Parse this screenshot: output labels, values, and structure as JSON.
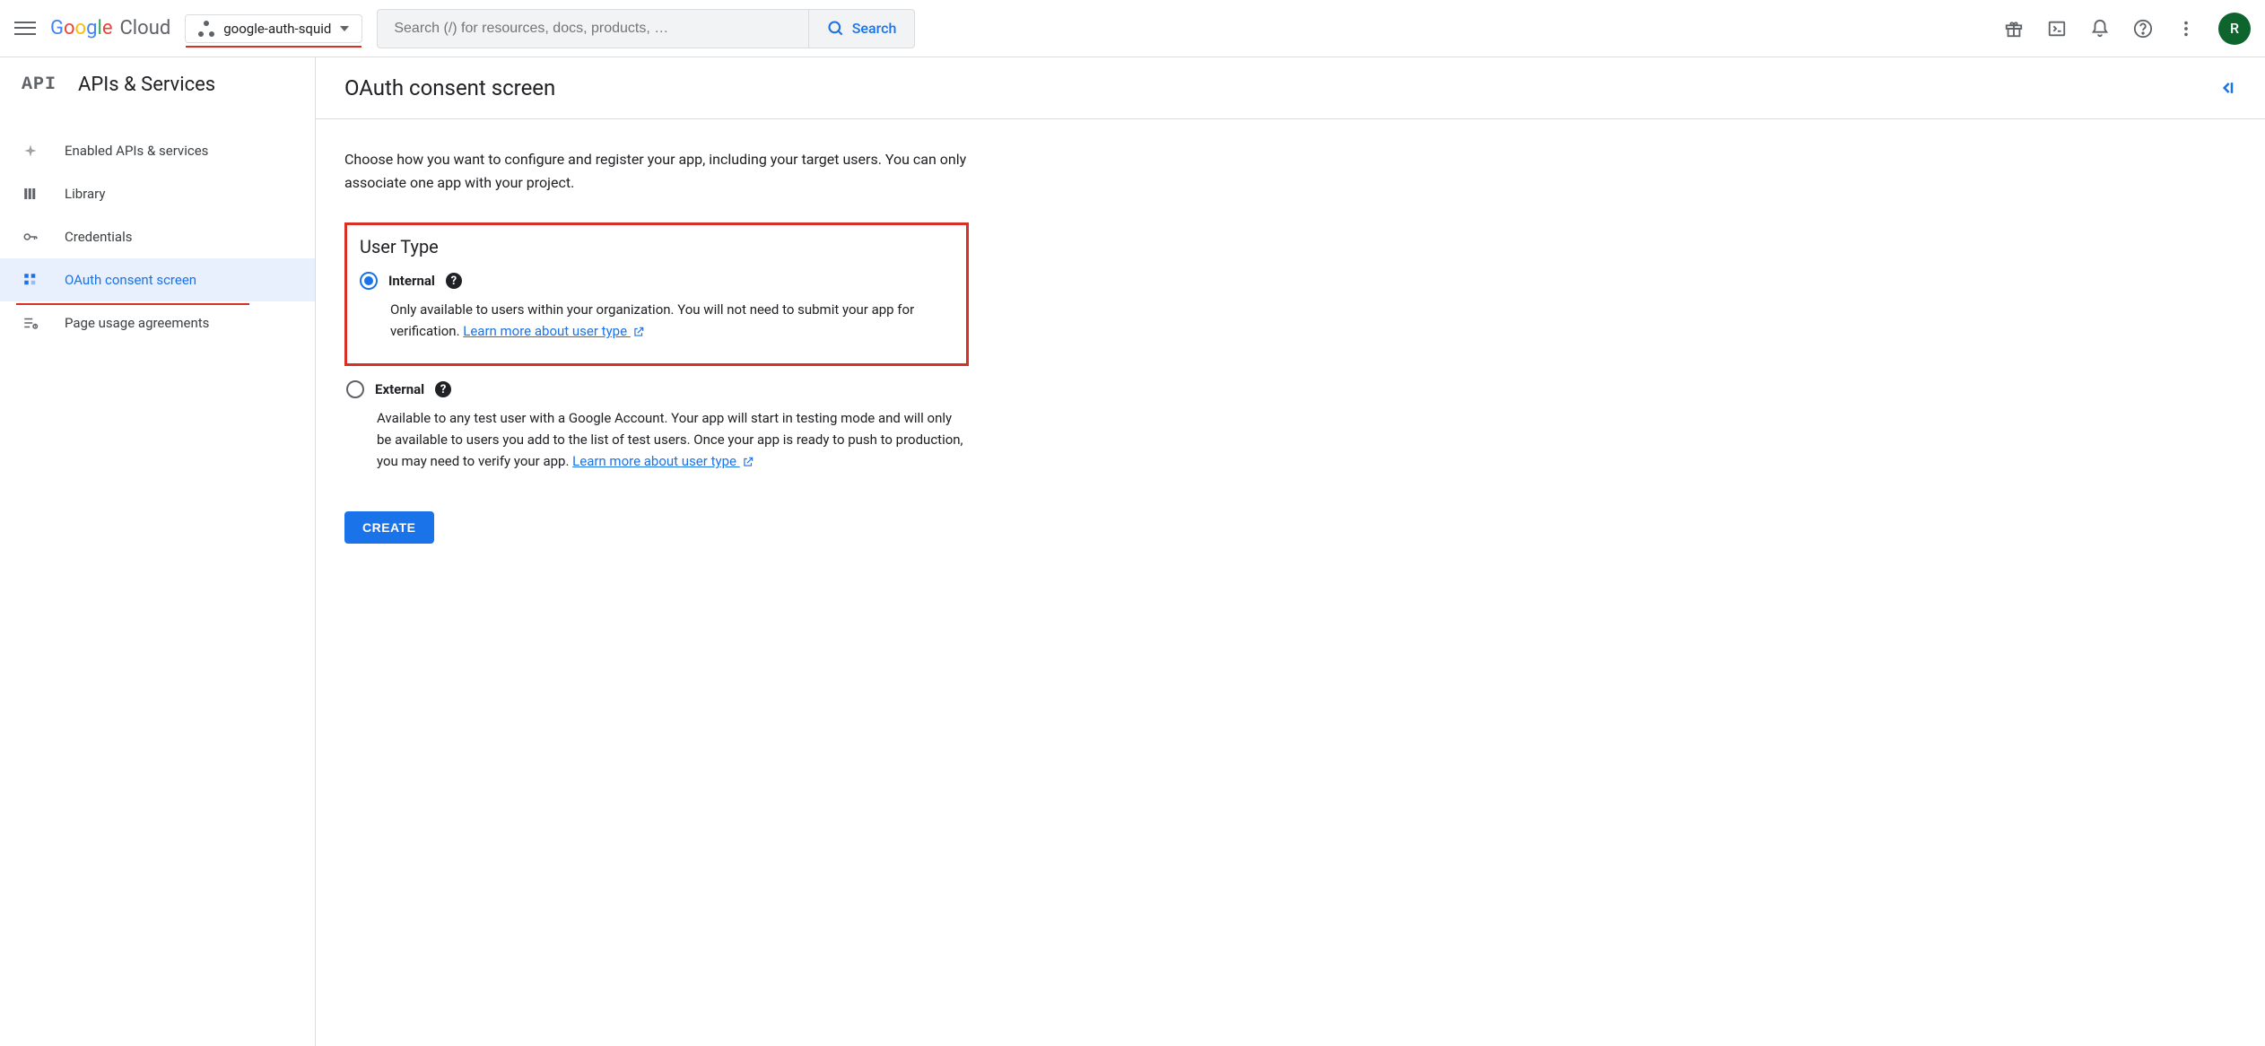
{
  "header": {
    "logo_cloud": "Cloud",
    "project_name": "google-auth-squid",
    "search_placeholder": "Search (/) for resources, docs, products, …",
    "search_button": "Search",
    "avatar_initial": "R"
  },
  "sidebar": {
    "api_badge": "API",
    "title": "APIs & Services",
    "items": [
      {
        "label": "Enabled APIs & services"
      },
      {
        "label": "Library"
      },
      {
        "label": "Credentials"
      },
      {
        "label": "OAuth consent screen"
      },
      {
        "label": "Page usage agreements"
      }
    ]
  },
  "main": {
    "title": "OAuth consent screen",
    "intro": "Choose how you want to configure and register your app, including your target users. You can only associate one app with your project.",
    "user_type_heading": "User Type",
    "internal": {
      "label": "Internal",
      "desc": "Only available to users within your organization. You will not need to submit your app for verification. ",
      "link": "Learn more about user type"
    },
    "external": {
      "label": "External",
      "desc": "Available to any test user with a Google Account. Your app will start in testing mode and will only be available to users you add to the list of test users. Once your app is ready to push to production, you may need to verify your app. ",
      "link": "Learn more about user type"
    },
    "create_button": "CREATE"
  }
}
